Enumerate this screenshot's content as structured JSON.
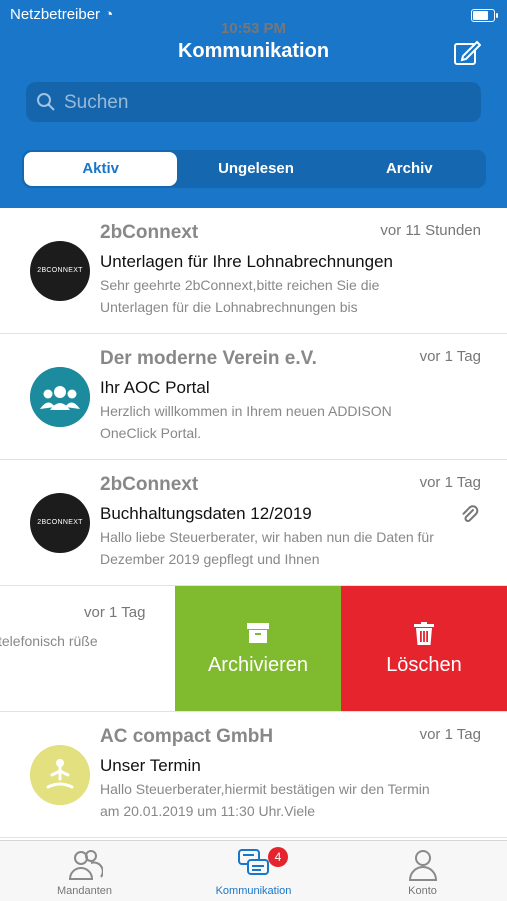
{
  "status_bar": {
    "carrier": "Netzbetreiber",
    "time": "10:53 PM",
    "battery_level": 0.85
  },
  "header": {
    "title": "Kommunikation",
    "compose_icon": "compose-icon"
  },
  "search": {
    "placeholder": "Suchen"
  },
  "segments": [
    "Aktiv",
    "Ungelesen",
    "Archiv"
  ],
  "messages": [
    {
      "sender": "2bConnext",
      "avatar_text": "2BCONNEXT",
      "time": "vor 11 Stunden",
      "subject": "Unterlagen für Ihre Lohnabrechnungen",
      "preview": "Sehr geehrte 2bConnext,bitte reichen Sie die Unterlagen für die Lohnabrechnungen bis"
    },
    {
      "sender": "Der moderne Verein e.V.",
      "time": "vor 1 Tag",
      "subject": "Ihr AOC Portal",
      "preview": "Herzlich willkommen in Ihrem neuen ADDISON OneClick Portal."
    },
    {
      "sender": "2bConnext",
      "avatar_text": "2BCONNEXT",
      "time": "vor 1 Tag",
      "subject": "Buchhaltungsdaten 12/2019",
      "preview": "Hallo liebe Steuerberater, wir haben nun die Daten für Dezember 2019 gepflegt und Ihnen",
      "attachment_icon": "paperclip-icon"
    },
    {
      "time": "vor 1 Tag",
      "preview": "telefonisch rüße",
      "actions": {
        "archive": "Archivieren",
        "delete": "Löschen"
      }
    },
    {
      "sender": "AC compact GmbH",
      "time": "vor 1 Tag",
      "subject": "Unser Termin",
      "preview": "Hallo Steuerberater,hiermit bestätigen wir den Termin am 20.01.2019 um 11:30 Uhr.Viele"
    }
  ],
  "tabbar": [
    {
      "label": "Mandanten",
      "icon": "clients-icon"
    },
    {
      "label": "Kommunikation",
      "icon": "chat-icon",
      "badge": "4"
    },
    {
      "label": "Konto",
      "icon": "account-icon"
    }
  ],
  "colors": {
    "primary": "#1976c9",
    "archive": "#7fba2f",
    "delete": "#e5242d",
    "badge": "#e5242d"
  }
}
